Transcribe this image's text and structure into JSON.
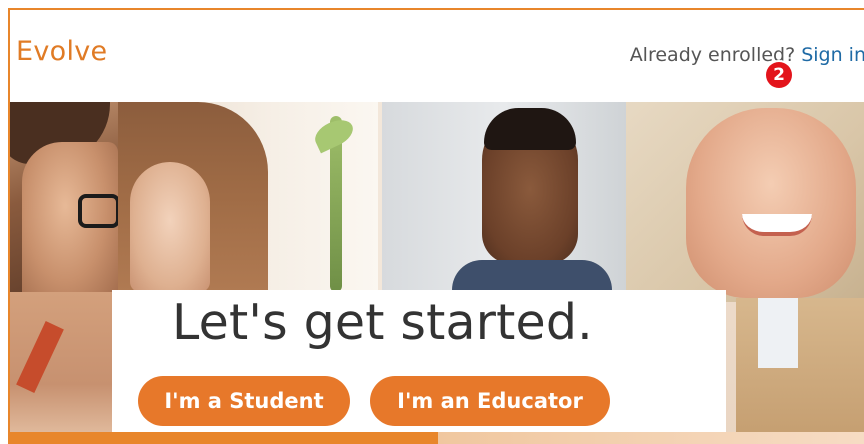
{
  "header": {
    "logo": "Evolve",
    "enroll_text": "Already enrolled?",
    "signin_label": "Sign in",
    "step_badge": "2"
  },
  "hero": {
    "headline": "Let's get started.",
    "student_button": "I'm a Student",
    "educator_button": "I'm an Educator"
  },
  "colors": {
    "brand": "#e07b25",
    "button": "#e7782a",
    "link": "#1f6aa5",
    "badge": "#e3141b"
  }
}
